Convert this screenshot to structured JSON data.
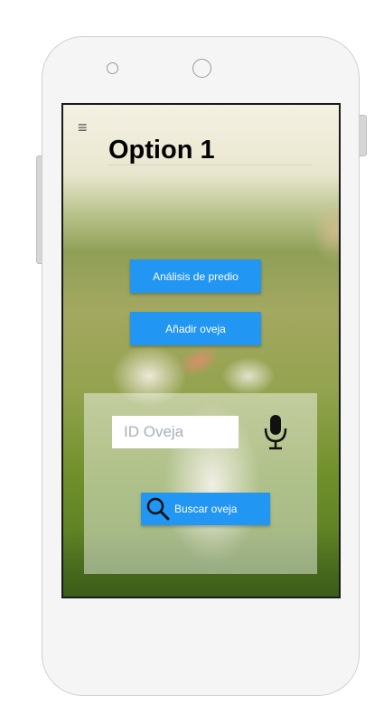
{
  "header": {
    "menu_icon": "hamburger-menu-icon",
    "title": "Option 1"
  },
  "actions": {
    "analisis_label": "Análisis de predio",
    "anadir_label": "Añadir oveja"
  },
  "search": {
    "placeholder": "ID Oveja",
    "value": "",
    "mic_icon": "microphone-icon",
    "search_icon": "magnifier-icon",
    "buscar_label": "Buscar oveja"
  },
  "colors": {
    "primary": "#2196f3",
    "title": "#000000",
    "panel": "rgba(255,255,255,0.45)"
  }
}
